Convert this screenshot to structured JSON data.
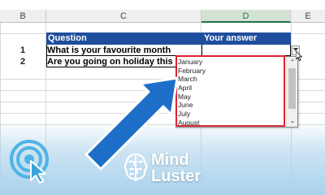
{
  "spreadsheet": {
    "columns": [
      {
        "letter": "B",
        "selected": false
      },
      {
        "letter": "C",
        "selected": false
      },
      {
        "letter": "D",
        "selected": true
      },
      {
        "letter": "E",
        "selected": false
      }
    ],
    "table": {
      "header": {
        "question": "Question",
        "answer": "Your answer"
      },
      "rows": [
        {
          "num": "1",
          "question": "What is your favourite month",
          "answer": ""
        },
        {
          "num": "2",
          "question": "Are you going on holiday this year",
          "answer": ""
        }
      ]
    }
  },
  "dropdown": {
    "options": [
      "January",
      "February",
      "March",
      "April",
      "May",
      "June",
      "July",
      "August"
    ],
    "scroll_up_glyph": "⌃",
    "scroll_down_glyph": "⌄"
  },
  "branding": {
    "line1": "Mind",
    "line2": "Luster"
  },
  "colors": {
    "header_fill": "#1f4e9c",
    "highlight_border": "#e0202e",
    "arrow": "#1e6fc7",
    "selected_column": "#217346"
  },
  "icons": {
    "dropdown_button": "chevron-down-icon",
    "cursor": "mouse-pointer-icon",
    "pointer_arrow": "big-arrow-icon",
    "logo": "target-click-icon",
    "brand_logo": "brain-icon"
  }
}
